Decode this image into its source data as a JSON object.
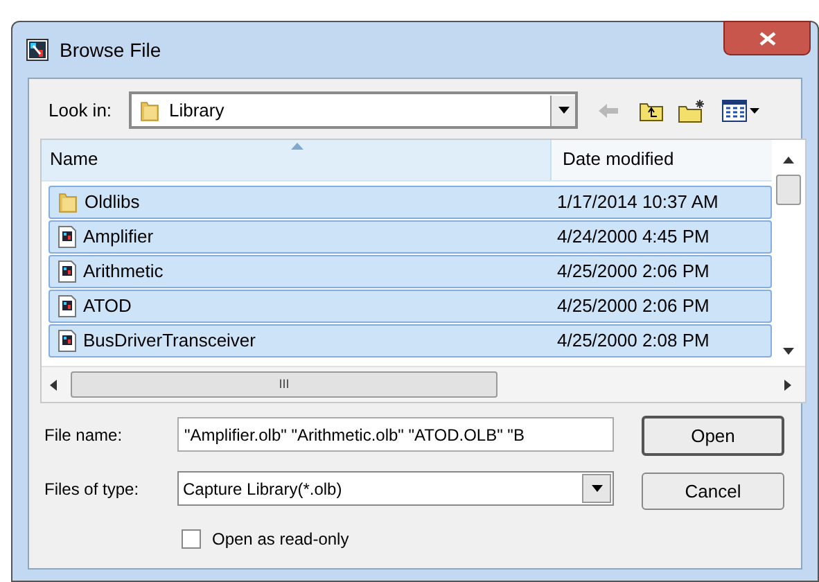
{
  "window": {
    "title": "Browse File"
  },
  "look_in": {
    "label": "Look in:",
    "value": "Library"
  },
  "file_list": {
    "columns": [
      {
        "label": "Name",
        "sorted": true
      },
      {
        "label": "Date modified",
        "sorted": false
      }
    ],
    "rows": [
      {
        "kind": "folder",
        "name": "Oldlibs",
        "date": "1/17/2014 10:37 AM",
        "selected": true
      },
      {
        "kind": "library",
        "name": "Amplifier",
        "date": "4/24/2000 4:45 PM",
        "selected": true
      },
      {
        "kind": "library",
        "name": "Arithmetic",
        "date": "4/25/2000 2:06 PM",
        "selected": true
      },
      {
        "kind": "library",
        "name": "ATOD",
        "date": "4/25/2000 2:06 PM",
        "selected": true
      },
      {
        "kind": "library",
        "name": "BusDriverTransceiver",
        "date": "4/25/2000 2:08 PM",
        "selected": true
      }
    ],
    "scroll_grip": "III"
  },
  "file_name": {
    "label": "File name:",
    "value": "\"Amplifier.olb\" \"Arithmetic.olb\" \"ATOD.OLB\" \"B"
  },
  "file_type": {
    "label": "Files of type:",
    "value": "Capture Library(*.olb)"
  },
  "read_only": {
    "label": "Open as read-only",
    "checked": false
  },
  "buttons": [
    "Open",
    "Cancel"
  ]
}
